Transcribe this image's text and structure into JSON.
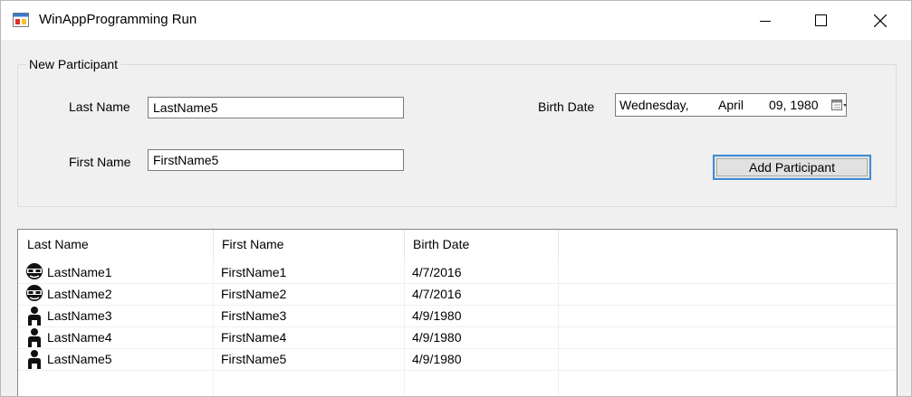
{
  "window": {
    "title": "WinAppProgramming Run",
    "icon": "winforms-app-icon"
  },
  "group": {
    "label": "New Participant"
  },
  "form": {
    "last_name_label": "Last Name",
    "last_name_value": "LastName5",
    "first_name_label": "First Name",
    "first_name_value": "FirstName5",
    "birth_date_label": "Birth Date",
    "birth_date": {
      "weekday": "Wednesday,",
      "month": "April",
      "day_year": "09, 1980"
    },
    "add_button_label": "Add Participant"
  },
  "list": {
    "columns": [
      "Last Name",
      "First Name",
      "Birth Date"
    ],
    "rows": [
      {
        "icon": "masked-person-icon",
        "last": "LastName1",
        "first": "FirstName1",
        "birth": "4/7/2016"
      },
      {
        "icon": "masked-person-icon",
        "last": "LastName2",
        "first": "FirstName2",
        "birth": "4/7/2016"
      },
      {
        "icon": "person-icon",
        "last": "LastName3",
        "first": "FirstName3",
        "birth": "4/9/1980"
      },
      {
        "icon": "person-icon",
        "last": "LastName4",
        "first": "FirstName4",
        "birth": "4/9/1980"
      },
      {
        "icon": "person-icon",
        "last": "LastName5",
        "first": "FirstName5",
        "birth": "4/9/1980"
      }
    ]
  },
  "colors": {
    "accent_focus": "#3d8bd6",
    "window_bg": "#f0f0f0"
  }
}
